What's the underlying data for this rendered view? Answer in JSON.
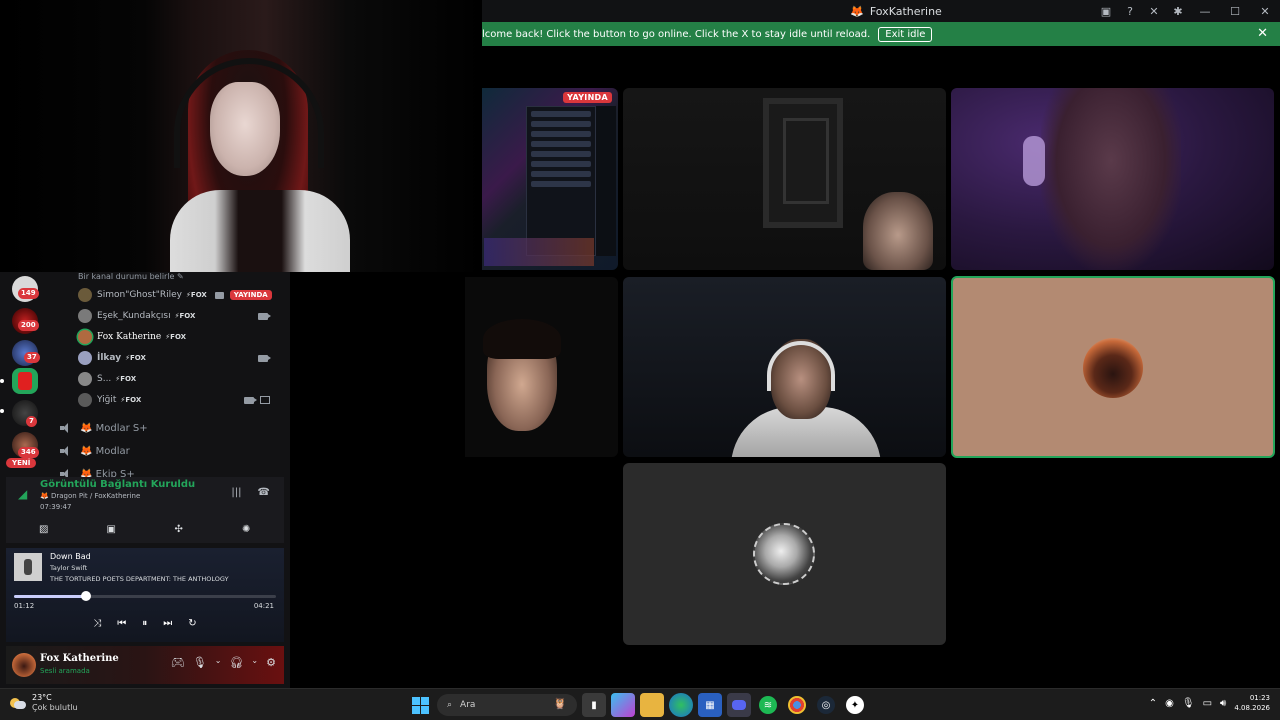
{
  "window": {
    "title": "FoxKatherine"
  },
  "banner": {
    "message": "lcome back! Click the button to go online. Click the X to stay idle until reload.",
    "exit_label": "Exit idle"
  },
  "stream_tile": {
    "live_badge": "YAYINDA"
  },
  "voice_channel": {
    "status_text": "Bir kanal durumu belirle ✎",
    "members": [
      {
        "name": "Simon\"Ghost\"Riley",
        "tag": "⚡FOX",
        "live": "YAYINDA",
        "camera": true
      },
      {
        "name": "Eşek_Kundakçısı",
        "tag": "⚡FOX",
        "camera": true
      },
      {
        "name": "Fox Katherine",
        "tag": "⚡FOX",
        "camera": false
      },
      {
        "name": "İlkay",
        "tag": "⚡FOX",
        "camera": true
      },
      {
        "name": "S...",
        "tag": "⚡FOX",
        "camera": false
      },
      {
        "name": "Yiğit",
        "tag": "⚡FOX",
        "camera": true
      }
    ],
    "other_channels": [
      "🦊 Modlar S+",
      "🦊 Modlar",
      "🦊 Ekip S+"
    ]
  },
  "guilds": {
    "badges": [
      "149",
      "200",
      "37",
      "7",
      "346"
    ],
    "new_label": "YENİ"
  },
  "voice_connection": {
    "status": "Görüntülü Bağlantı Kuruldu",
    "location": "🦊 Dragon Pit / FoxKatherine",
    "elapsed": "07:39:47"
  },
  "music": {
    "title": "Down Bad",
    "artist": "Taylor Swift",
    "album": "THE TORTURED POETS DEPARTMENT: THE ANTHOLOGY",
    "current_time": "01:12",
    "duration": "04:21",
    "progress": 0.276
  },
  "user": {
    "name": "Fox Katherine",
    "status": "Sesli aramada"
  },
  "taskbar": {
    "weather_temp": "23°C",
    "weather_desc": "Çok bulutlu",
    "search_placeholder": "Ara",
    "time": "01:23",
    "date": "4.08.2026"
  },
  "colors": {
    "banner_green": "#248046",
    "live_red": "#da373c",
    "speaking_green": "#23a55a",
    "avatar_tile_bg": "#b38a72"
  }
}
